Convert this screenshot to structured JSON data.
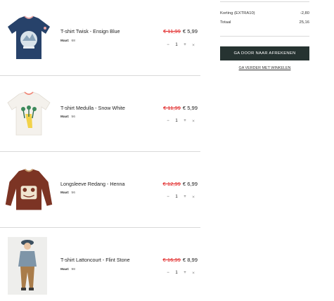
{
  "cart": {
    "items": [
      {
        "name": "T-shirt Twisk - Ensign Blue",
        "size_label": "Maat:",
        "size": "68",
        "old_price": "€ 11,99",
        "new_price": "€ 5,99",
        "qty": "1",
        "minus": "−",
        "plus": "+",
        "remove": "×",
        "image": "navy-tshirt"
      },
      {
        "name": "T-shirt Medulla - Snow White",
        "size_label": "Maat:",
        "size": "56",
        "old_price": "€ 11,99",
        "new_price": "€ 5,99",
        "qty": "1",
        "minus": "−",
        "plus": "+",
        "remove": "×",
        "image": "white-tshirt"
      },
      {
        "name": "Longsleeve Redang - Henna",
        "size_label": "Maat:",
        "size": "56",
        "old_price": "€ 12,99",
        "new_price": "€ 6,99",
        "qty": "1",
        "minus": "−",
        "plus": "+",
        "remove": "×",
        "image": "henna-longsleeve"
      },
      {
        "name": "T-shirt Lattoncourt - Flint Stone",
        "size_label": "Maat:",
        "size": "98",
        "old_price": "€ 16,99",
        "new_price": "€ 8,99",
        "qty": "1",
        "minus": "−",
        "plus": "+",
        "remove": "×",
        "image": "boy-photo"
      }
    ]
  },
  "summary": {
    "discount_label": "Korting (EXTRA10)",
    "discount_value": "-2,80",
    "total_label": "Totaal",
    "total_value": "25,16",
    "checkout_label": "GA DOOR NAAR AFREKENEN",
    "continue_label": "GA VERDER MET WINKELEN"
  },
  "colors": {
    "checkout_bg": "#263331",
    "old_price": "#e02020",
    "navy": "#27426a",
    "henna": "#7c3424"
  }
}
